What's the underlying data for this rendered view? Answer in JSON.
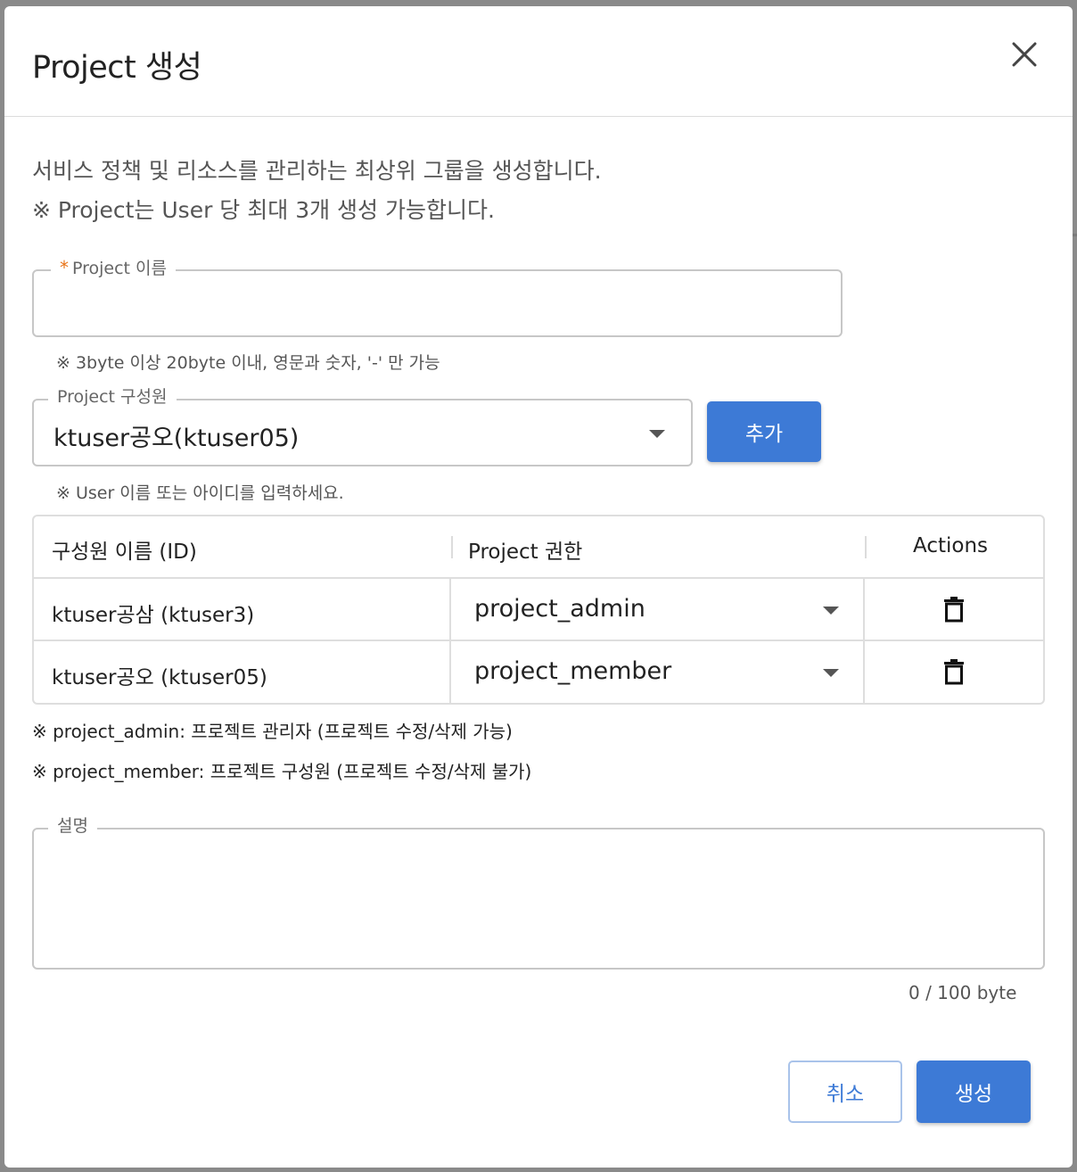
{
  "dialog": {
    "title": "Project 생성",
    "description_line1": "서비스 정책 및 리소스를 관리하는 최상위 그룹을 생성합니다.",
    "description_line2": "※ Project는 User 당 최대 3개 생성 가능합니다."
  },
  "project_name": {
    "required_mark": "*",
    "label": "Project 이름",
    "value": "",
    "hint": "※ 3byte 이상 20byte 이내, 영문과 숫자, '-' 만 가능"
  },
  "member_select": {
    "label": "Project 구성원",
    "value": "ktuser공오(ktuser05)",
    "add_button": "추가",
    "hint": "※ User 이름 또는 아이디를 입력하세요."
  },
  "members_table": {
    "headers": [
      "구성원 이름 (ID)",
      "Project 권한",
      "Actions"
    ],
    "rows": [
      {
        "name": "ktuser공삼 (ktuser3)",
        "role": "project_admin",
        "action_icon": "trash-icon"
      },
      {
        "name": "ktuser공오 (ktuser05)",
        "role": "project_member",
        "action_icon": "trash-icon"
      }
    ]
  },
  "role_notes": {
    "admin": "※ project_admin: 프로젝트 관리자 (프로젝트 수정/삭제 가능)",
    "member": "※ project_member: 프로젝트 구성원 (프로젝트 수정/삭제 불가)"
  },
  "description_field": {
    "label": "설명",
    "value": "",
    "counter": "0 / 100 byte"
  },
  "footer": {
    "cancel": "취소",
    "create": "생성"
  },
  "colors": {
    "primary": "#3d7ad6",
    "required": "#e8741a",
    "border": "#c7c7c7"
  }
}
